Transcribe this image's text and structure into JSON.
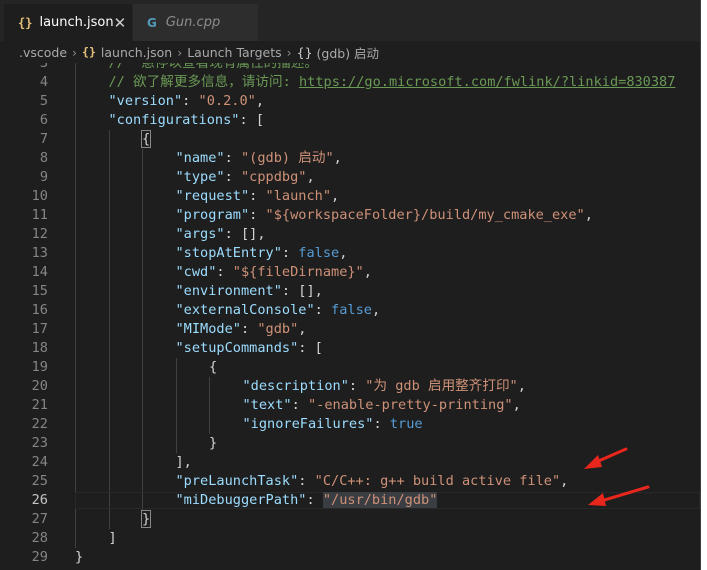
{
  "tabs": [
    {
      "label": "launch.json",
      "icon": "json-braces-icon",
      "icon_glyph": "{}",
      "active": true,
      "close_glyph": "✕"
    },
    {
      "label": "Gun.cpp",
      "icon": "cpp-file-icon",
      "icon_glyph": "G",
      "active": false
    }
  ],
  "breadcrumb": {
    "items": [
      ".vscode",
      "launch.json",
      "Launch Targets",
      "(gdb) 启动"
    ],
    "separator": "›",
    "json_icon_glyph": "{}",
    "object_icon_glyph": "{}"
  },
  "editor": {
    "current_line": 26,
    "lines": [
      {
        "n": "3",
        "indent": 1,
        "tokens": [
          {
            "t": "//  悬停以查看现有属性的描述。",
            "c": "c"
          }
        ]
      },
      {
        "n": "4",
        "indent": 1,
        "tokens": [
          {
            "t": "// 欲了解更多信息，请访问: ",
            "c": "c"
          },
          {
            "t": "https://go.microsoft.com/fwlink/?linkid=830387",
            "c": "u"
          }
        ]
      },
      {
        "n": "5",
        "indent": 1,
        "tokens": [
          {
            "t": "\"version\"",
            "c": "k"
          },
          {
            "t": ": ",
            "c": "p"
          },
          {
            "t": "\"0.2.0\"",
            "c": "s"
          },
          {
            "t": ",",
            "c": "p"
          }
        ]
      },
      {
        "n": "6",
        "indent": 1,
        "tokens": [
          {
            "t": "\"configurations\"",
            "c": "k"
          },
          {
            "t": ": [",
            "c": "p"
          }
        ]
      },
      {
        "n": "7",
        "indent": 2,
        "tokens": [
          {
            "t": "{",
            "c": "p bm"
          }
        ]
      },
      {
        "n": "8",
        "indent": 3,
        "tokens": [
          {
            "t": "\"name\"",
            "c": "k"
          },
          {
            "t": ": ",
            "c": "p"
          },
          {
            "t": "\"(gdb) 启动\"",
            "c": "s"
          },
          {
            "t": ",",
            "c": "p"
          }
        ]
      },
      {
        "n": "9",
        "indent": 3,
        "tokens": [
          {
            "t": "\"type\"",
            "c": "k"
          },
          {
            "t": ": ",
            "c": "p"
          },
          {
            "t": "\"cppdbg\"",
            "c": "s"
          },
          {
            "t": ",",
            "c": "p"
          }
        ]
      },
      {
        "n": "10",
        "indent": 3,
        "tokens": [
          {
            "t": "\"request\"",
            "c": "k"
          },
          {
            "t": ": ",
            "c": "p"
          },
          {
            "t": "\"launch\"",
            "c": "s"
          },
          {
            "t": ",",
            "c": "p"
          }
        ]
      },
      {
        "n": "11",
        "indent": 3,
        "tokens": [
          {
            "t": "\"program\"",
            "c": "k"
          },
          {
            "t": ": ",
            "c": "p"
          },
          {
            "t": "\"${workspaceFolder}/build/my_cmake_exe\"",
            "c": "s"
          },
          {
            "t": ",",
            "c": "p"
          }
        ]
      },
      {
        "n": "12",
        "indent": 3,
        "tokens": [
          {
            "t": "\"args\"",
            "c": "k"
          },
          {
            "t": ": [],",
            "c": "p"
          }
        ]
      },
      {
        "n": "13",
        "indent": 3,
        "tokens": [
          {
            "t": "\"stopAtEntry\"",
            "c": "k"
          },
          {
            "t": ": ",
            "c": "p"
          },
          {
            "t": "false",
            "c": "b"
          },
          {
            "t": ",",
            "c": "p"
          }
        ]
      },
      {
        "n": "14",
        "indent": 3,
        "tokens": [
          {
            "t": "\"cwd\"",
            "c": "k"
          },
          {
            "t": ": ",
            "c": "p"
          },
          {
            "t": "\"${fileDirname}\"",
            "c": "s"
          },
          {
            "t": ",",
            "c": "p"
          }
        ]
      },
      {
        "n": "15",
        "indent": 3,
        "tokens": [
          {
            "t": "\"environment\"",
            "c": "k"
          },
          {
            "t": ": [],",
            "c": "p"
          }
        ]
      },
      {
        "n": "16",
        "indent": 3,
        "tokens": [
          {
            "t": "\"externalConsole\"",
            "c": "k"
          },
          {
            "t": ": ",
            "c": "p"
          },
          {
            "t": "false",
            "c": "b"
          },
          {
            "t": ",",
            "c": "p"
          }
        ]
      },
      {
        "n": "17",
        "indent": 3,
        "tokens": [
          {
            "t": "\"MIMode\"",
            "c": "k"
          },
          {
            "t": ": ",
            "c": "p"
          },
          {
            "t": "\"gdb\"",
            "c": "s"
          },
          {
            "t": ",",
            "c": "p"
          }
        ]
      },
      {
        "n": "18",
        "indent": 3,
        "tokens": [
          {
            "t": "\"setupCommands\"",
            "c": "k"
          },
          {
            "t": ": [",
            "c": "p"
          }
        ]
      },
      {
        "n": "19",
        "indent": 4,
        "tokens": [
          {
            "t": "{",
            "c": "p"
          }
        ]
      },
      {
        "n": "20",
        "indent": 5,
        "tokens": [
          {
            "t": "\"description\"",
            "c": "k"
          },
          {
            "t": ": ",
            "c": "p"
          },
          {
            "t": "\"为 gdb 启用整齐打印\"",
            "c": "s"
          },
          {
            "t": ",",
            "c": "p"
          }
        ]
      },
      {
        "n": "21",
        "indent": 5,
        "tokens": [
          {
            "t": "\"text\"",
            "c": "k"
          },
          {
            "t": ": ",
            "c": "p"
          },
          {
            "t": "\"-enable-pretty-printing\"",
            "c": "s"
          },
          {
            "t": ",",
            "c": "p"
          }
        ]
      },
      {
        "n": "22",
        "indent": 5,
        "tokens": [
          {
            "t": "\"ignoreFailures\"",
            "c": "k"
          },
          {
            "t": ": ",
            "c": "p"
          },
          {
            "t": "true",
            "c": "b"
          }
        ]
      },
      {
        "n": "23",
        "indent": 4,
        "tokens": [
          {
            "t": "}",
            "c": "p"
          }
        ]
      },
      {
        "n": "24",
        "indent": 3,
        "tokens": [
          {
            "t": "],",
            "c": "p"
          }
        ]
      },
      {
        "n": "25",
        "indent": 3,
        "tokens": [
          {
            "t": "\"preLaunchTask\"",
            "c": "k"
          },
          {
            "t": ": ",
            "c": "p"
          },
          {
            "t": "\"C/C++: g++ build active file\"",
            "c": "s"
          },
          {
            "t": ",",
            "c": "p"
          }
        ]
      },
      {
        "n": "26",
        "indent": 3,
        "tokens": [
          {
            "t": "\"miDebuggerPath\"",
            "c": "k"
          },
          {
            "t": ": ",
            "c": "p"
          },
          {
            "t": "\"/usr/bin/gdb\"",
            "c": "s hl"
          }
        ]
      },
      {
        "n": "27",
        "indent": 2,
        "tokens": [
          {
            "t": "}",
            "c": "p bm"
          }
        ]
      },
      {
        "n": "28",
        "indent": 1,
        "tokens": [
          {
            "t": "]",
            "c": "p"
          }
        ]
      },
      {
        "n": "29",
        "indent": 0,
        "tokens": [
          {
            "t": "}",
            "c": "p"
          }
        ]
      }
    ]
  },
  "annotations": {
    "arrow_color": "#e8261c",
    "arrow_icon": "red-arrow-icon"
  }
}
